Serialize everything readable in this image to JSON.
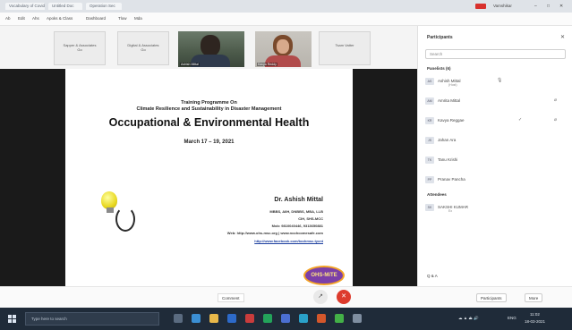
{
  "browser": {
    "tabs": [
      "Vocabulary of Covid",
      "Untitled Doc",
      "Operation Sec"
    ],
    "record_badge": "REC",
    "user_label": "Vamshikar",
    "window_controls": [
      "–",
      "□",
      "✕"
    ]
  },
  "bookmarks": [
    "Ab",
    "Edit",
    "Ahs",
    "Apoks & Class",
    "Dashboard",
    "Tlow",
    "Mda"
  ],
  "strip": {
    "tiles": [
      {
        "name": "Sapper & Associates",
        "sub": "Go"
      },
      {
        "name": "Digital & Associates",
        "sub": "Go"
      }
    ],
    "right_tile": "Tsam Vatter",
    "cam1_name": "Ashish Mittal",
    "cam2_name": "Kavya Reddy"
  },
  "slide": {
    "line1": "Training Programme On",
    "line2": "Climate Resilience and Sustainability in Disaster Management",
    "title": "Occupational & Environmental Health",
    "date": "March 17 – 19, 2021",
    "author": "Dr. Ashish Mittal",
    "info": [
      "MBBS, AIIH, DNBBS, MBA, LLB",
      "CIH, SHS-MCC",
      "Mob: 9810040446, 9313650881",
      "Web: http://www.ohs-msc.org | www.ncohcomesafe.com"
    ],
    "link": "http://www.facebook.com/toohmsc.tycnt",
    "logo_text": "OHS-MiTE"
  },
  "panel": {
    "title": "Participants",
    "search_placeholder": "Search",
    "section1": "Panelists (6)",
    "participants": [
      {
        "initials": "AS",
        "name": "Ashish Mittal",
        "sub": "(Host)"
      },
      {
        "initials": "AM",
        "name": "Amrita Mittal",
        "sub": ""
      },
      {
        "initials": "KR",
        "name": "Kavya Reggae",
        "sub": ""
      },
      {
        "initials": "JS",
        "name": "Jahan Ara",
        "sub": ""
      },
      {
        "initials": "TK",
        "name": "Tanu Krishi",
        "sub": ""
      },
      {
        "initials": "PP",
        "name": "Pranav Pancha",
        "sub": ""
      }
    ],
    "section2": "Attendees",
    "attendee": {
      "initials": "SK",
      "name": "SAKSHI KUMAR",
      "sub": "Ex"
    },
    "bottom": "Q & A"
  },
  "controls": {
    "toast": "Comment",
    "participants_button": "Participants",
    "more_button": "More"
  },
  "taskbar": {
    "search_placeholder": "Type here to search",
    "time": "11:02",
    "date": "18-03-2021",
    "lang": "ENG"
  }
}
